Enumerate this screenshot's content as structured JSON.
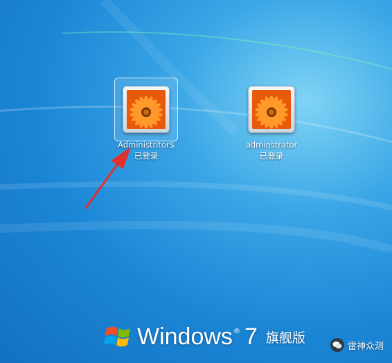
{
  "users": [
    {
      "username": "Administritor$",
      "status": "已登录",
      "selected": true,
      "avatar_icon": "flower-icon"
    },
    {
      "username": "adminstrator",
      "status": "已登录",
      "selected": false,
      "avatar_icon": "flower-icon"
    }
  ],
  "branding": {
    "word": "Windows",
    "registered": "®",
    "version": "7",
    "edition": "旗舰版"
  },
  "watermark": {
    "text": "雷神众测",
    "icon": "wechat-icon"
  },
  "annotation": {
    "arrow_color": "#e0322c"
  },
  "colors": {
    "background": "#1b86d6",
    "avatar_petals": "#f47a10"
  }
}
